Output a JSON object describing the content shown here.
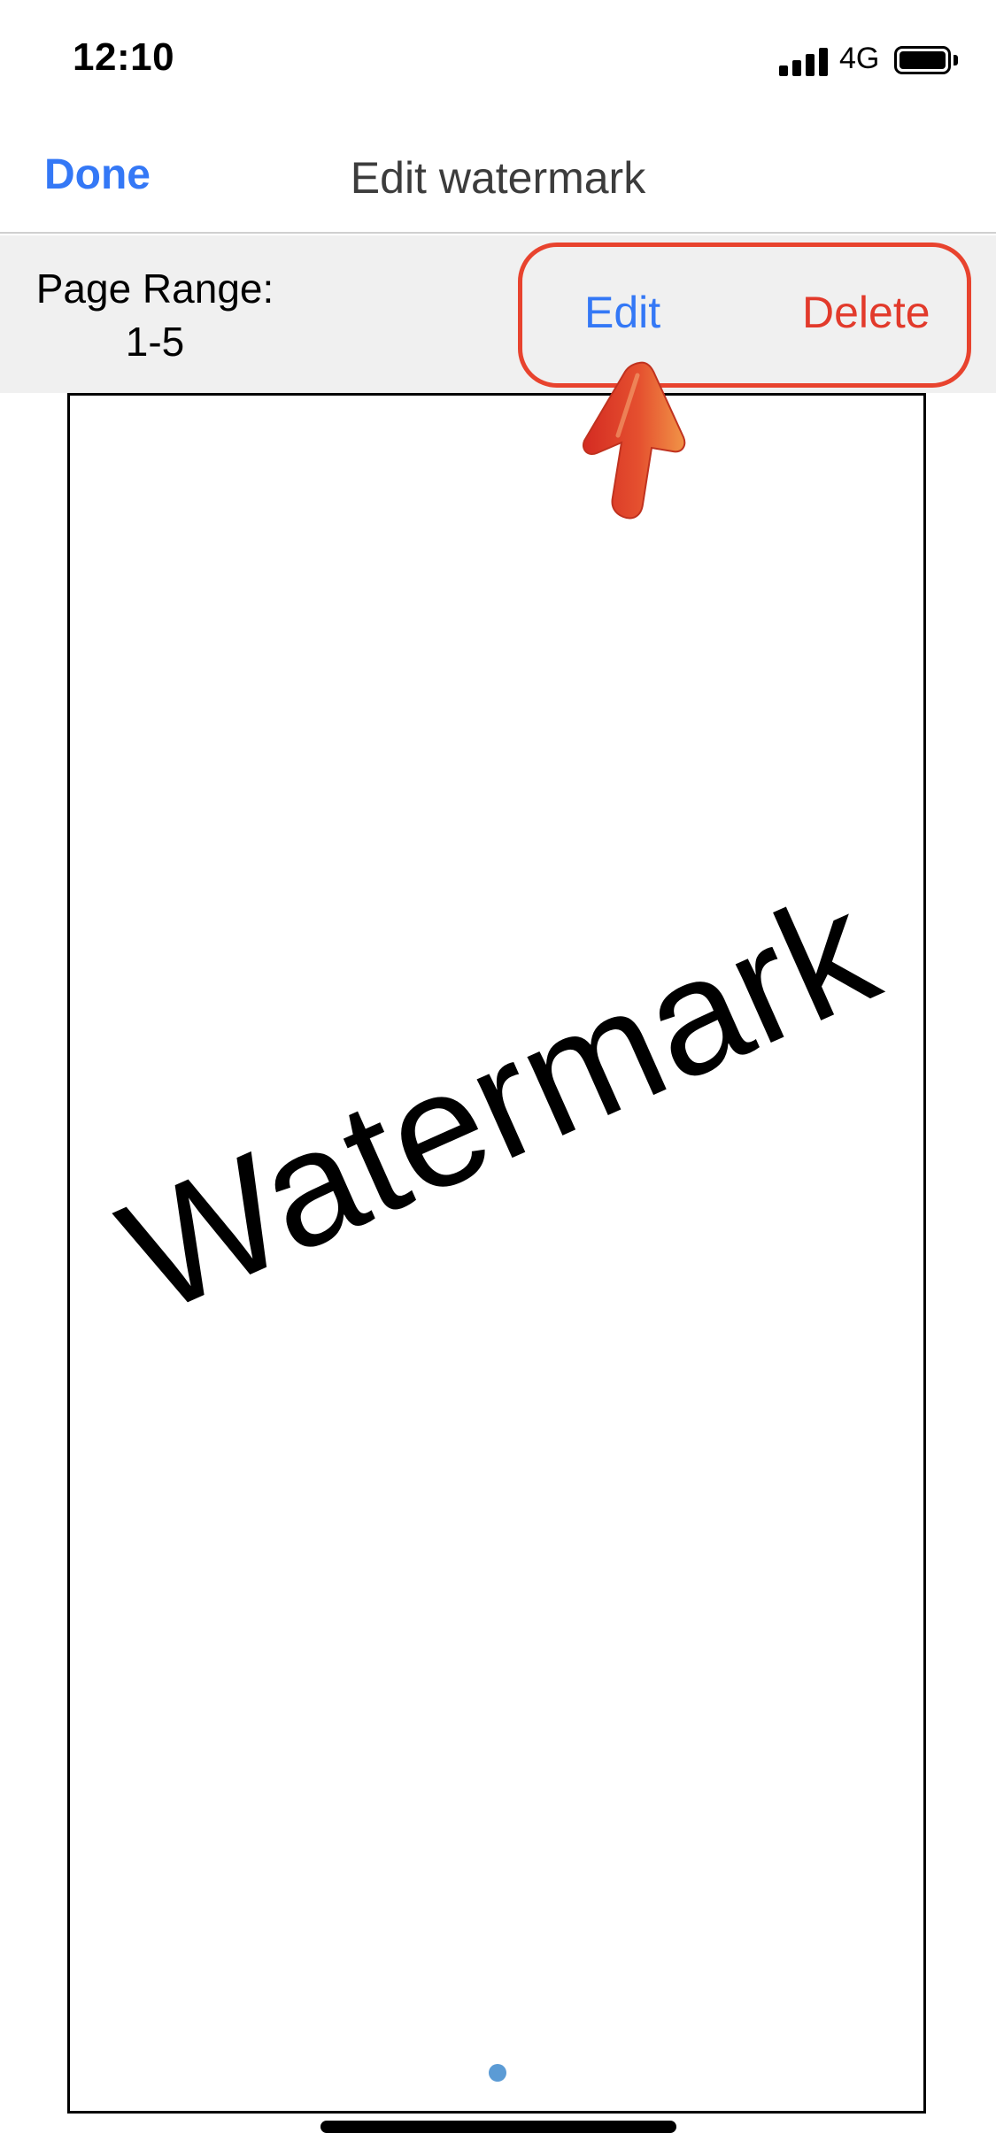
{
  "status_bar": {
    "time": "12:10",
    "network": "4G",
    "signal_icon": "signal-bars-icon",
    "battery_icon": "battery-full-icon"
  },
  "nav": {
    "done_label": "Done",
    "title": "Edit watermark"
  },
  "toolbar": {
    "page_range_label": "Page Range:",
    "page_range_value": "1-5",
    "edit_label": "Edit",
    "delete_label": "Delete"
  },
  "preview": {
    "watermark_text": "Watermark"
  },
  "colors": {
    "accent_blue": "#3478f6",
    "delete_red": "#e23a2b",
    "highlight_red": "#e8432e",
    "toolbar_bg": "#f0f0f0",
    "page_indicator": "#5b9bd5"
  }
}
